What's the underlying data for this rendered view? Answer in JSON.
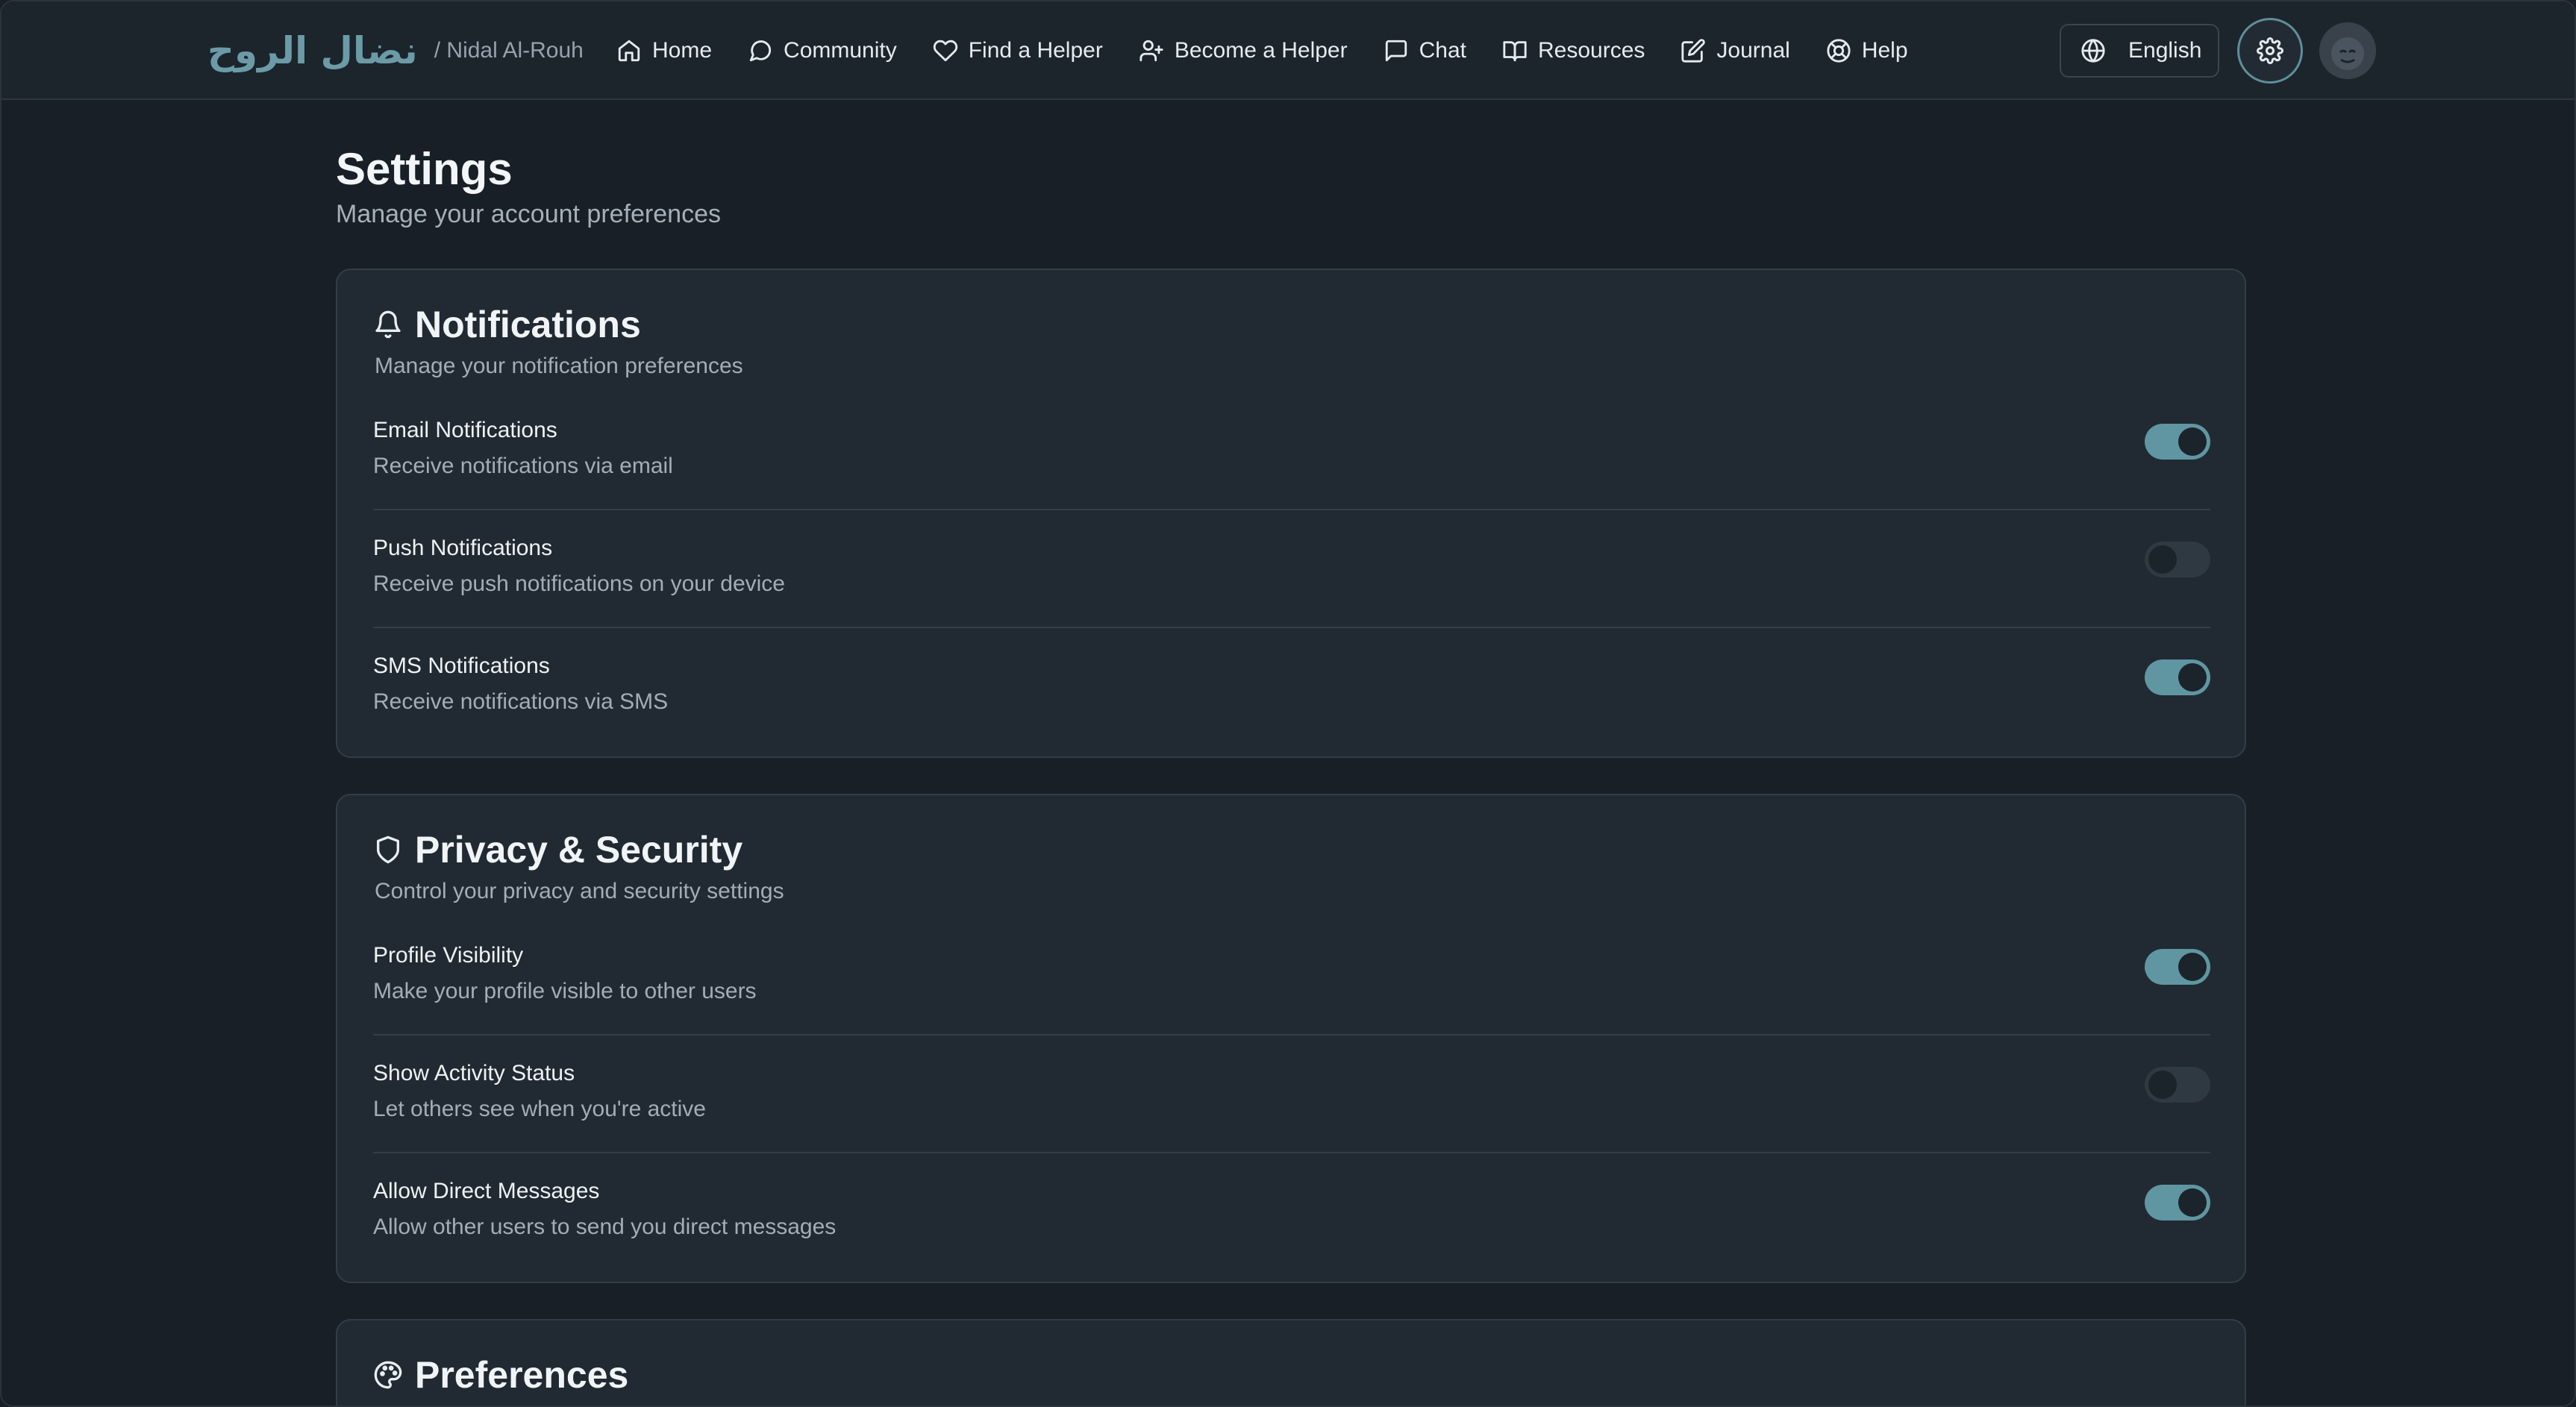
{
  "brand": {
    "name_arabic": "نضال الروح",
    "name_latin": "/ Nidal Al-Rouh"
  },
  "nav": {
    "items": [
      {
        "label": "Home",
        "icon": "home-icon"
      },
      {
        "label": "Community",
        "icon": "message-circle-icon"
      },
      {
        "label": "Find a Helper",
        "icon": "heart-icon"
      },
      {
        "label": "Become a Helper",
        "icon": "user-plus-icon"
      },
      {
        "label": "Chat",
        "icon": "chat-square-icon"
      },
      {
        "label": "Resources",
        "icon": "book-open-icon"
      },
      {
        "label": "Journal",
        "icon": "edit-icon"
      },
      {
        "label": "Help",
        "icon": "life-buoy-icon"
      }
    ],
    "language": "English",
    "accent_color": "#5f96a2"
  },
  "page": {
    "title": "Settings",
    "subtitle": "Manage your account preferences"
  },
  "sections": {
    "notifications": {
      "title": "Notifications",
      "description": "Manage your notification preferences",
      "icon": "bell-icon",
      "items": [
        {
          "label": "Email Notifications",
          "description": "Receive notifications via email",
          "enabled": true
        },
        {
          "label": "Push Notifications",
          "description": "Receive push notifications on your device",
          "enabled": false
        },
        {
          "label": "SMS Notifications",
          "description": "Receive notifications via SMS",
          "enabled": true
        }
      ]
    },
    "privacy": {
      "title": "Privacy & Security",
      "description": "Control your privacy and security settings",
      "icon": "shield-icon",
      "items": [
        {
          "label": "Profile Visibility",
          "description": "Make your profile visible to other users",
          "enabled": true
        },
        {
          "label": "Show Activity Status",
          "description": "Let others see when you're active",
          "enabled": false
        },
        {
          "label": "Allow Direct Messages",
          "description": "Allow other users to send you direct messages",
          "enabled": true
        }
      ]
    },
    "preferences": {
      "title": "Preferences",
      "icon": "palette-icon"
    }
  }
}
